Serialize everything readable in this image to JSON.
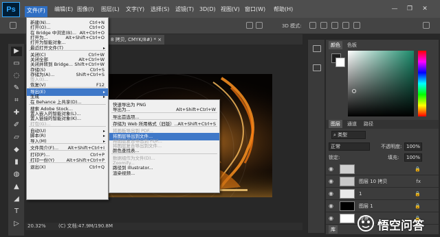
{
  "app": {
    "logo": "Ps"
  },
  "menubar": {
    "items": [
      "文件(F)",
      "编辑(E)",
      "图像(I)",
      "图层(L)",
      "文字(Y)",
      "选择(S)",
      "滤镜(T)",
      "3D(D)",
      "视图(V)",
      "窗口(W)",
      "帮助(H)"
    ],
    "active_index": 0
  },
  "window_controls": {
    "minimize": "—",
    "restore": "❐",
    "close": "✕"
  },
  "options_bar": {
    "mode_3d": "3D 模式:"
  },
  "document": {
    "tab_title": "8 拷贝, CMYK/8#) *",
    "tab_close": "×",
    "zoom": "20.32%",
    "doc_info": "(C)  文档:47.9M/190.8M"
  },
  "tools": [
    "▶",
    "▭",
    "◌",
    "✎",
    "⌗",
    "✚",
    "✐",
    "▱",
    "◆",
    "▮",
    "◍",
    "▲",
    "◢",
    "T",
    "▷"
  ],
  "file_menu": {
    "items": [
      {
        "label": "新建(N)...",
        "shortcut": "Ctrl+N"
      },
      {
        "label": "打开(O)...",
        "shortcut": "Ctrl+O"
      },
      {
        "label": "在 Bridge 中浏览(B)...",
        "shortcut": "Alt+Ctrl+O"
      },
      {
        "label": "打开为...",
        "shortcut": "Alt+Shift+Ctrl+O"
      },
      {
        "label": "打开为智能对象...",
        "shortcut": ""
      },
      {
        "label": "最近打开文件(T)",
        "shortcut": "",
        "submenu": true
      },
      {
        "sep": true
      },
      {
        "label": "关闭(C)",
        "shortcut": "Ctrl+W"
      },
      {
        "label": "关闭全部",
        "shortcut": "Alt+Ctrl+W"
      },
      {
        "label": "关闭并转到 Bridge...",
        "shortcut": "Shift+Ctrl+W"
      },
      {
        "label": "存储(S)",
        "shortcut": "Ctrl+S"
      },
      {
        "label": "存储为(A)...",
        "shortcut": "Shift+Ctrl+S"
      },
      {
        "label": "签入(I)...",
        "shortcut": "",
        "disabled": true
      },
      {
        "label": "恢复(V)",
        "shortcut": "F12"
      },
      {
        "sep": true
      },
      {
        "label": "导出(E)",
        "shortcut": "",
        "submenu": true,
        "highlighted": true
      },
      {
        "label": "生成",
        "shortcut": "",
        "submenu": true
      },
      {
        "label": "在 Behance 上共享(D)...",
        "shortcut": ""
      },
      {
        "sep": true
      },
      {
        "label": "搜索 Adobe Stock...",
        "shortcut": ""
      },
      {
        "label": "置入嵌入的智能对象(L)...",
        "shortcut": ""
      },
      {
        "label": "置入链接的智能对象(K)...",
        "shortcut": ""
      },
      {
        "label": "打包(G)...",
        "shortcut": "",
        "disabled": true
      },
      {
        "sep": true
      },
      {
        "label": "自动(U)",
        "shortcut": "",
        "submenu": true
      },
      {
        "label": "脚本(R)",
        "shortcut": "",
        "submenu": true
      },
      {
        "label": "导入(M)",
        "shortcut": "",
        "submenu": true
      },
      {
        "sep": true
      },
      {
        "label": "文件简介(F)...",
        "shortcut": "Alt+Shift+Ctrl+I"
      },
      {
        "sep": true
      },
      {
        "label": "打印(P)...",
        "shortcut": "Ctrl+P"
      },
      {
        "label": "打印一份(Y)",
        "shortcut": "Alt+Shift+Ctrl+P"
      },
      {
        "sep": true
      },
      {
        "label": "退出(X)",
        "shortcut": "Ctrl+Q"
      }
    ]
  },
  "export_submenu": {
    "items": [
      {
        "label": "快速导出为 PNG",
        "shortcut": ""
      },
      {
        "label": "导出为...",
        "shortcut": "Alt+Shift+Ctrl+W"
      },
      {
        "sep": true
      },
      {
        "label": "导出首选项...",
        "shortcut": ""
      },
      {
        "sep": true
      },
      {
        "label": "存储为 Web 所用格式（旧版）...",
        "shortcut": "Alt+Shift+Ctrl+S"
      },
      {
        "sep": true
      },
      {
        "label": "将画板导出到 PDF...",
        "shortcut": "",
        "disabled": true
      },
      {
        "label": "将图层导出到文件...",
        "shortcut": "",
        "highlighted": true
      },
      {
        "label": "将图层复合导出到 PDF...",
        "shortcut": "",
        "disabled": true
      },
      {
        "label": "将图层复合导出到文件...",
        "shortcut": "",
        "disabled": true
      },
      {
        "label": "颜色查找表...",
        "shortcut": ""
      },
      {
        "sep": true
      },
      {
        "label": "数据组作为文件(D)...",
        "shortcut": "",
        "disabled": true
      },
      {
        "label": "Zoomify...",
        "shortcut": "",
        "disabled": true
      },
      {
        "label": "路径到 Illustrator...",
        "shortcut": ""
      },
      {
        "label": "渲染视频...",
        "shortcut": ""
      }
    ]
  },
  "color_panel": {
    "tabs": [
      "颜色",
      "色板"
    ]
  },
  "layers_panel": {
    "tabs": [
      "图层",
      "通道",
      "路径"
    ],
    "filter": "类型",
    "blend_mode": "正常",
    "opacity_label": "不透明度:",
    "opacity_value": "100%",
    "lock_label": "锁定:",
    "fill_label": "填充:",
    "fill_value": "100%",
    "layers": [
      {
        "name": "",
        "thumb": "#d0d0d0"
      },
      {
        "name": "图层 10 拷贝",
        "thumb": "#c8c8c8",
        "fx": "fx"
      },
      {
        "name": "1",
        "thumb": "#e8e8e8"
      },
      {
        "name": "图层 1",
        "thumb": "#000000"
      },
      {
        "name": "背景",
        "thumb": "#ffffff"
      }
    ],
    "bottom_tab": "库"
  },
  "watermark": {
    "text": "悟空问答"
  },
  "colors": {
    "menu_highlight": "#3f78c8",
    "menubar_bg": "#4e4e4e",
    "fire_orange": "#f08a1e"
  }
}
